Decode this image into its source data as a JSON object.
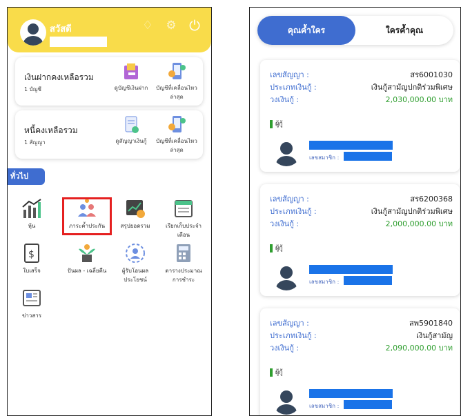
{
  "left_screen": {
    "header": {
      "greeting": "สวัสดี",
      "icons": [
        "bell-icon",
        "gear-icon",
        "power-icon"
      ]
    },
    "savings_card": {
      "title": "เงินฝากคงเหลือรวม",
      "count": "1 บัญชี",
      "actions": [
        {
          "label": "ดูบัญชีเงินฝาก",
          "icon": "passbook-icon"
        },
        {
          "label": "บัญชีที่เคลื่อนไหวล่าสุด",
          "icon": "phone-transaction-icon"
        }
      ]
    },
    "loan_card": {
      "title": "หนี้คงเหลือรวม",
      "count": "1 สัญญา",
      "actions": [
        {
          "label": "ดูสัญญาเงินกู้",
          "icon": "contract-icon"
        },
        {
          "label": "บัญชีที่เคลื่อนไหวล่าสุด",
          "icon": "phone-transaction-icon"
        }
      ]
    },
    "section_label": "ทั่วไป",
    "menu": [
      {
        "label": "หุ้น",
        "icon": "stock-chart-icon"
      },
      {
        "label": "ภาระค้ำประกัน",
        "icon": "guarantor-icon"
      },
      {
        "label": "สรุปยอดรวม",
        "icon": "summary-icon"
      },
      {
        "label": "เรียกเก็บประจำเดือน",
        "icon": "calendar-icon"
      },
      {
        "label": "ใบเสร็จ",
        "icon": "receipt-icon"
      },
      {
        "label": "ปันผล - เฉลี่ยคืน",
        "icon": "dividend-plant-icon"
      },
      {
        "label": "ผู้รับโอนผลประโยชน์",
        "icon": "beneficiary-icon"
      },
      {
        "label": "ตารางประมาณการชำระ",
        "icon": "calculator-icon"
      },
      {
        "label": "ข่าวสาร",
        "icon": "news-icon"
      }
    ],
    "colors": {
      "header": "#f9dc4a",
      "accent": "#3f6dd0",
      "highlight": "#e52020"
    }
  },
  "right_screen": {
    "tabs": [
      {
        "label": "คุณค้ำใคร",
        "active": true
      },
      {
        "label": "ใครค้ำคุณ",
        "active": false
      }
    ],
    "contract_label": "เลขสัญญา :",
    "type_label": "ประเภทเงินกู้ :",
    "amount_label": "วงเงินกู้ :",
    "guarantor_label": "ผู้กู้",
    "member_label": "เลขสมาชิก :",
    "contracts": [
      {
        "number": "สร6001030",
        "type": "เงินกู้สามัญปกติร่วมพิเศษ",
        "amount": "2,030,000.00 บาท"
      },
      {
        "number": "สร6200368",
        "type": "เงินกู้สามัญปกติร่วมพิเศษ",
        "amount": "2,000,000.00 บาท"
      },
      {
        "number": "สพ5901840",
        "type": "เงินกู้สามัญ",
        "amount": "2,090,000.00 บาท"
      }
    ],
    "colors": {
      "tab_active": "#3f6dd0",
      "amount": "#2f9e2f",
      "label": "#3f6dd0",
      "redaction": "#1a73e8"
    }
  }
}
